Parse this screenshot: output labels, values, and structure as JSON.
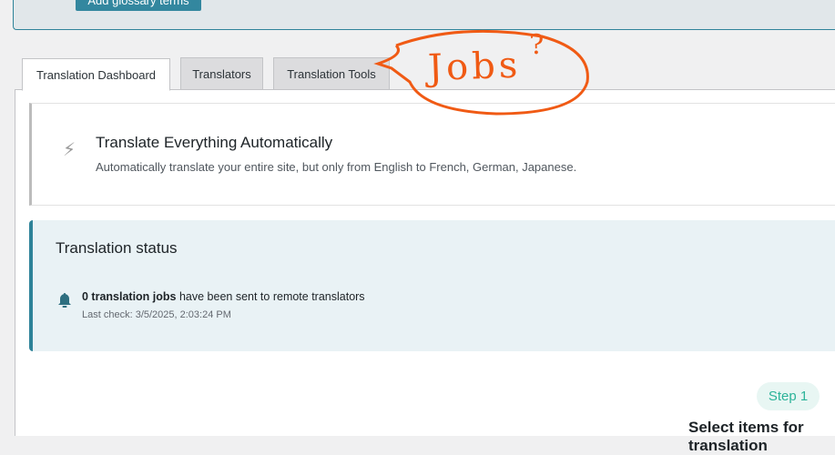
{
  "top": {
    "glossary_button": "Add glossary terms"
  },
  "tabs": [
    {
      "label": "Translation Dashboard",
      "active": true
    },
    {
      "label": "Translators",
      "active": false
    },
    {
      "label": "Translation Tools",
      "active": false
    }
  ],
  "auto_translate": {
    "icon": "bolt-icon",
    "title": "Translate Everything Automatically",
    "description": "Automatically translate your entire site, but only from English to French, German, Japanese."
  },
  "status": {
    "title": "Translation status",
    "jobs_bold": "0 translation jobs",
    "jobs_rest": " have been sent to remote translators",
    "last_check": "Last check: 3/5/2025, 2:03:24 PM"
  },
  "step": {
    "badge": "Step 1",
    "title": "Select items for translation"
  },
  "annotation": {
    "text": "Jobs",
    "mark": "?",
    "color": "#f05a14"
  }
}
